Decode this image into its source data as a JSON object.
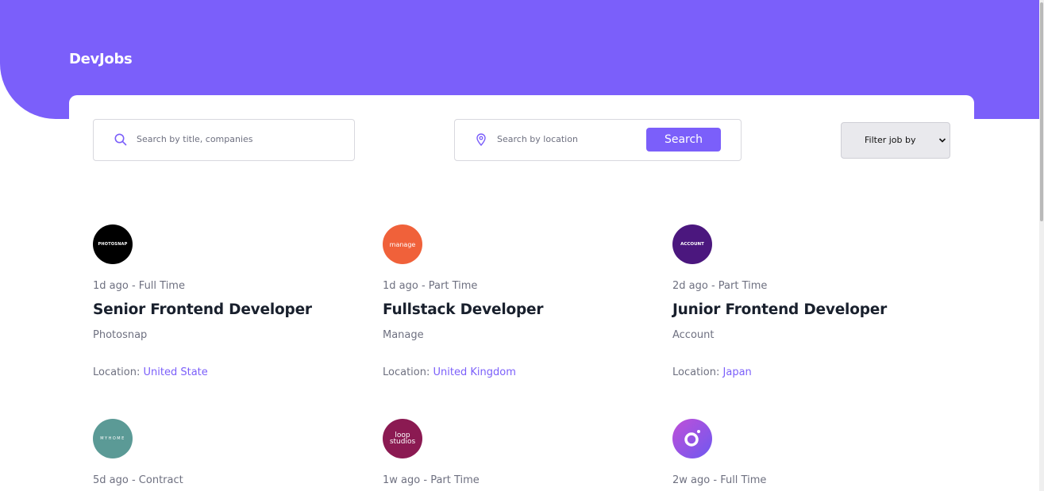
{
  "brand": {
    "name": "DevJobs",
    "accent": "#7b5ffa"
  },
  "search": {
    "title_placeholder": "Search by title, companies",
    "location_placeholder": "Search by location",
    "button_label": "Search",
    "filter_label": "Filter job by"
  },
  "jobs": [
    {
      "posted": "1d ago",
      "type": "Full Time",
      "title": "Senior Frontend Developer",
      "company": "Photosnap",
      "location_label": "Location:",
      "location": "United State",
      "logo_text": "PHOTOSNAP",
      "logo_color": "#000000",
      "logo_icon": "photosnap-logo-icon"
    },
    {
      "posted": "1d ago",
      "type": "Part Time",
      "title": "Fullstack Developer",
      "company": "Manage",
      "location_label": "Location:",
      "location": "United Kingdom",
      "logo_text": "manage",
      "logo_color": "#f0613a",
      "logo_icon": "manage-logo-icon"
    },
    {
      "posted": "2d ago",
      "type": "Part Time",
      "title": "Junior Frontend Developer",
      "company": "Account",
      "location_label": "Location:",
      "location": "Japan",
      "logo_text": "ACCOUNT",
      "logo_color": "#4b177e",
      "logo_icon": "account-logo-icon"
    },
    {
      "posted": "5d ago",
      "type": "Contract",
      "title": "",
      "company": "",
      "location_label": "",
      "location": "",
      "logo_text": "MYHOME",
      "logo_color": "#5b9a96",
      "logo_icon": "myhome-logo-icon"
    },
    {
      "posted": "1w ago",
      "type": "Part Time",
      "title": "",
      "company": "",
      "location_label": "",
      "location": "",
      "logo_text": "loop studios",
      "logo_color": "#8b1a52",
      "logo_icon": "loopstudios-logo-icon"
    },
    {
      "posted": "2w ago",
      "type": "Full Time",
      "title": "",
      "company": "",
      "location_label": "",
      "location": "",
      "logo_text": "",
      "logo_color": "#9b4ff0",
      "logo_icon": "faceit-logo-icon"
    }
  ]
}
